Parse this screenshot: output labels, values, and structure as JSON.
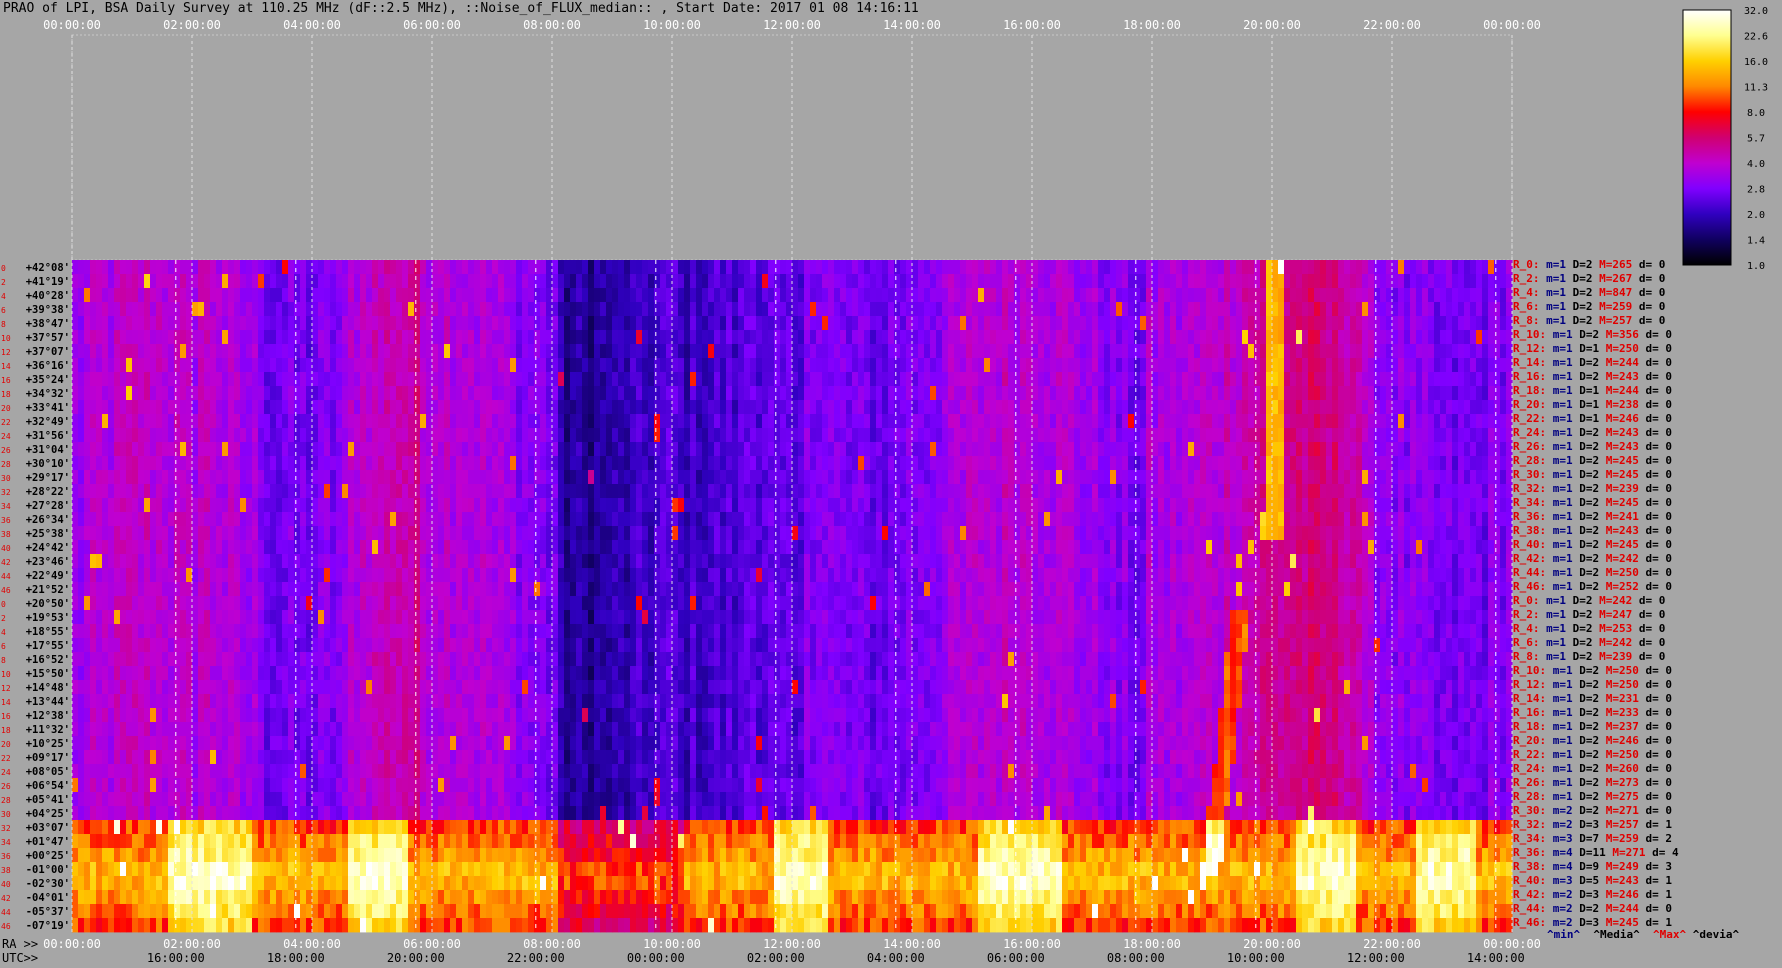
{
  "title": "PRAO of LPI, BSA Daily Survey at 110.25 MHz (dF::2.5 MHz), ::Noise_of_FLUX_median:: , Start Date: 2017 01 08 14:16:11",
  "colors": {
    "background": "#a6a6a6",
    "accent_red": "#e00000",
    "accent_blue": "#000080"
  },
  "chart_data": {
    "type": "heatmap",
    "title": "PRAO of LPI, BSA Daily Survey at 110.25 MHz (dF::2.5 MHz), ::Noise_of_FLUX_median:: , Start Date: 2017 01 08 14:16:11",
    "top_time_ticks": [
      "00:00:00",
      "02:00:00",
      "04:00:00",
      "06:00:00",
      "08:00:00",
      "10:00:00",
      "12:00:00",
      "14:00:00",
      "16:00:00",
      "18:00:00",
      "20:00:00",
      "22:00:00",
      "00:00:00"
    ],
    "ra_axis_label": "RA >>",
    "ra_ticks": [
      "00:00:00",
      "02:00:00",
      "04:00:00",
      "06:00:00",
      "08:00:00",
      "10:00:00",
      "12:00:00",
      "14:00:00",
      "16:00:00",
      "18:00:00",
      "20:00:00",
      "22:00:00",
      "00:00:00"
    ],
    "utc_axis_label": "UTC>>",
    "utc_ticks": [
      "16:00:00",
      "18:00:00",
      "20:00:00",
      "22:00:00",
      "00:00:00",
      "02:00:00",
      "04:00:00",
      "06:00:00",
      "08:00:00",
      "10:00:00",
      "12:00:00",
      "14:00:00"
    ],
    "row_indices": [
      "0",
      "2",
      "4",
      "6",
      "8",
      "10",
      "12",
      "14",
      "16",
      "18",
      "20",
      "22",
      "24",
      "26",
      "28",
      "30",
      "32",
      "34",
      "36",
      "38",
      "40",
      "42",
      "44",
      "46",
      "0",
      "2",
      "4",
      "6",
      "8",
      "10",
      "12",
      "14",
      "16",
      "18",
      "20",
      "22",
      "24",
      "26",
      "28",
      "30",
      "32",
      "34",
      "36",
      "38",
      "40",
      "42",
      "44",
      "46"
    ],
    "declinations": [
      "+42°08'",
      "+41°19'",
      "+40°28'",
      "+39°38'",
      "+38°47'",
      "+37°57'",
      "+37°07'",
      "+36°16'",
      "+35°24'",
      "+34°32'",
      "+33°41'",
      "+32°49'",
      "+31°56'",
      "+31°04'",
      "+30°10'",
      "+29°17'",
      "+28°22'",
      "+27°28'",
      "+26°34'",
      "+25°38'",
      "+24°42'",
      "+23°46'",
      "+22°49'",
      "+21°52'",
      "+20°50'",
      "+19°53'",
      "+18°55'",
      "+17°55'",
      "+16°52'",
      "+15°50'",
      "+14°48'",
      "+13°44'",
      "+12°38'",
      "+11°32'",
      "+10°25'",
      "+09°17'",
      "+08°05'",
      "+06°54'",
      "+05°41'",
      "+04°25'",
      "+03°07'",
      "+01°47'",
      "+00°25'",
      "-01°00'",
      "-02°30'",
      "-04°01'",
      "-05°37'",
      "-07°19'"
    ],
    "colorbar": {
      "ticks": [
        "32.0",
        "22.6",
        "16.0",
        "11.3",
        "8.0",
        "5.7",
        "4.0",
        "2.8",
        "2.0",
        "1.4",
        "1.0"
      ],
      "colors": [
        "#ffffff",
        "#ffff90",
        "#ffd000",
        "#ff8800",
        "#ff0000",
        "#d00070",
        "#c000d0",
        "#8000ff",
        "#3000c0",
        "#100060",
        "#000000"
      ]
    },
    "row_stats": [
      {
        "name": "R_0:",
        "min": "m=1",
        "d": "D=2",
        "max": "M=265",
        "dev": "d= 0"
      },
      {
        "name": "R_2:",
        "min": "m=1",
        "d": "D=2",
        "max": "M=267",
        "dev": "d= 0"
      },
      {
        "name": "R_4:",
        "min": "m=1",
        "d": "D=2",
        "max": "M=847",
        "dev": "d= 0"
      },
      {
        "name": "R_6:",
        "min": "m=1",
        "d": "D=2",
        "max": "M=259",
        "dev": "d= 0"
      },
      {
        "name": "R_8:",
        "min": "m=1",
        "d": "D=2",
        "max": "M=257",
        "dev": "d= 0"
      },
      {
        "name": "R_10:",
        "min": "m=1",
        "d": "D=2",
        "max": "M=356",
        "dev": "d= 0"
      },
      {
        "name": "R_12:",
        "min": "m=1",
        "d": "D=1",
        "max": "M=250",
        "dev": "d= 0"
      },
      {
        "name": "R_14:",
        "min": "m=1",
        "d": "D=2",
        "max": "M=244",
        "dev": "d= 0"
      },
      {
        "name": "R_16:",
        "min": "m=1",
        "d": "D=2",
        "max": "M=243",
        "dev": "d= 0"
      },
      {
        "name": "R_18:",
        "min": "m=1",
        "d": "D=1",
        "max": "M=244",
        "dev": "d= 0"
      },
      {
        "name": "R_20:",
        "min": "m=1",
        "d": "D=1",
        "max": "M=238",
        "dev": "d= 0"
      },
      {
        "name": "R_22:",
        "min": "m=1",
        "d": "D=1",
        "max": "M=246",
        "dev": "d= 0"
      },
      {
        "name": "R_24:",
        "min": "m=1",
        "d": "D=2",
        "max": "M=243",
        "dev": "d= 0"
      },
      {
        "name": "R_26:",
        "min": "m=1",
        "d": "D=2",
        "max": "M=243",
        "dev": "d= 0"
      },
      {
        "name": "R_28:",
        "min": "m=1",
        "d": "D=2",
        "max": "M=245",
        "dev": "d= 0"
      },
      {
        "name": "R_30:",
        "min": "m=1",
        "d": "D=2",
        "max": "M=245",
        "dev": "d= 0"
      },
      {
        "name": "R_32:",
        "min": "m=1",
        "d": "D=2",
        "max": "M=239",
        "dev": "d= 0"
      },
      {
        "name": "R_34:",
        "min": "m=1",
        "d": "D=2",
        "max": "M=245",
        "dev": "d= 0"
      },
      {
        "name": "R_36:",
        "min": "m=1",
        "d": "D=2",
        "max": "M=241",
        "dev": "d= 0"
      },
      {
        "name": "R_38:",
        "min": "m=1",
        "d": "D=2",
        "max": "M=243",
        "dev": "d= 0"
      },
      {
        "name": "R_40:",
        "min": "m=1",
        "d": "D=2",
        "max": "M=245",
        "dev": "d= 0"
      },
      {
        "name": "R_42:",
        "min": "m=1",
        "d": "D=2",
        "max": "M=242",
        "dev": "d= 0"
      },
      {
        "name": "R_44:",
        "min": "m=1",
        "d": "D=2",
        "max": "M=250",
        "dev": "d= 0"
      },
      {
        "name": "R_46:",
        "min": "m=1",
        "d": "D=2",
        "max": "M=252",
        "dev": "d= 0"
      },
      {
        "name": "R_0:",
        "min": "m=1",
        "d": "D=2",
        "max": "M=242",
        "dev": "d= 0"
      },
      {
        "name": "R_2:",
        "min": "m=1",
        "d": "D=2",
        "max": "M=247",
        "dev": "d= 0"
      },
      {
        "name": "R_4:",
        "min": "m=1",
        "d": "D=2",
        "max": "M=253",
        "dev": "d= 0"
      },
      {
        "name": "R_6:",
        "min": "m=1",
        "d": "D=2",
        "max": "M=242",
        "dev": "d= 0"
      },
      {
        "name": "R_8:",
        "min": "m=1",
        "d": "D=2",
        "max": "M=239",
        "dev": "d= 0"
      },
      {
        "name": "R_10:",
        "min": "m=1",
        "d": "D=2",
        "max": "M=250",
        "dev": "d= 0"
      },
      {
        "name": "R_12:",
        "min": "m=1",
        "d": "D=2",
        "max": "M=250",
        "dev": "d= 0"
      },
      {
        "name": "R_14:",
        "min": "m=1",
        "d": "D=2",
        "max": "M=231",
        "dev": "d= 0"
      },
      {
        "name": "R_16:",
        "min": "m=1",
        "d": "D=2",
        "max": "M=233",
        "dev": "d= 0"
      },
      {
        "name": "R_18:",
        "min": "m=1",
        "d": "D=2",
        "max": "M=237",
        "dev": "d= 0"
      },
      {
        "name": "R_20:",
        "min": "m=1",
        "d": "D=2",
        "max": "M=246",
        "dev": "d= 0"
      },
      {
        "name": "R_22:",
        "min": "m=1",
        "d": "D=2",
        "max": "M=250",
        "dev": "d= 0"
      },
      {
        "name": "R_24:",
        "min": "m=1",
        "d": "D=2",
        "max": "M=260",
        "dev": "d= 0"
      },
      {
        "name": "R_26:",
        "min": "m=1",
        "d": "D=2",
        "max": "M=273",
        "dev": "d= 0"
      },
      {
        "name": "R_28:",
        "min": "m=1",
        "d": "D=2",
        "max": "M=275",
        "dev": "d= 0"
      },
      {
        "name": "R_30:",
        "min": "m=2",
        "d": "D=2",
        "max": "M=271",
        "dev": "d= 0"
      },
      {
        "name": "R_32:",
        "min": "m=2",
        "d": "D=3",
        "max": "M=257",
        "dev": "d= 1"
      },
      {
        "name": "R_34:",
        "min": "m=3",
        "d": "D=7",
        "max": "M=259",
        "dev": "d= 2"
      },
      {
        "name": "R_36:",
        "min": "m=4",
        "d": "D=11",
        "max": "M=271",
        "dev": "d= 4"
      },
      {
        "name": "R_38:",
        "min": "m=4",
        "d": "D=9",
        "max": "M=249",
        "dev": "d= 3"
      },
      {
        "name": "R_40:",
        "min": "m=3",
        "d": "D=5",
        "max": "M=243",
        "dev": "d= 1"
      },
      {
        "name": "R_42:",
        "min": "m=2",
        "d": "D=3",
        "max": "M=246",
        "dev": "d= 1"
      },
      {
        "name": "R_44:",
        "min": "m=2",
        "d": "D=2",
        "max": "M=244",
        "dev": "d= 0"
      },
      {
        "name": "R_46:",
        "min": "m=2",
        "d": "D=3",
        "max": "M=245",
        "dev": "d= 1"
      }
    ],
    "stats_legend": {
      "min": "^min^",
      "median": "^Media^",
      "max": "^Max^",
      "dev": "^devia^"
    },
    "bright_band_rows": [
      40,
      47
    ],
    "bright_source_ra_hours": 20.0
  }
}
